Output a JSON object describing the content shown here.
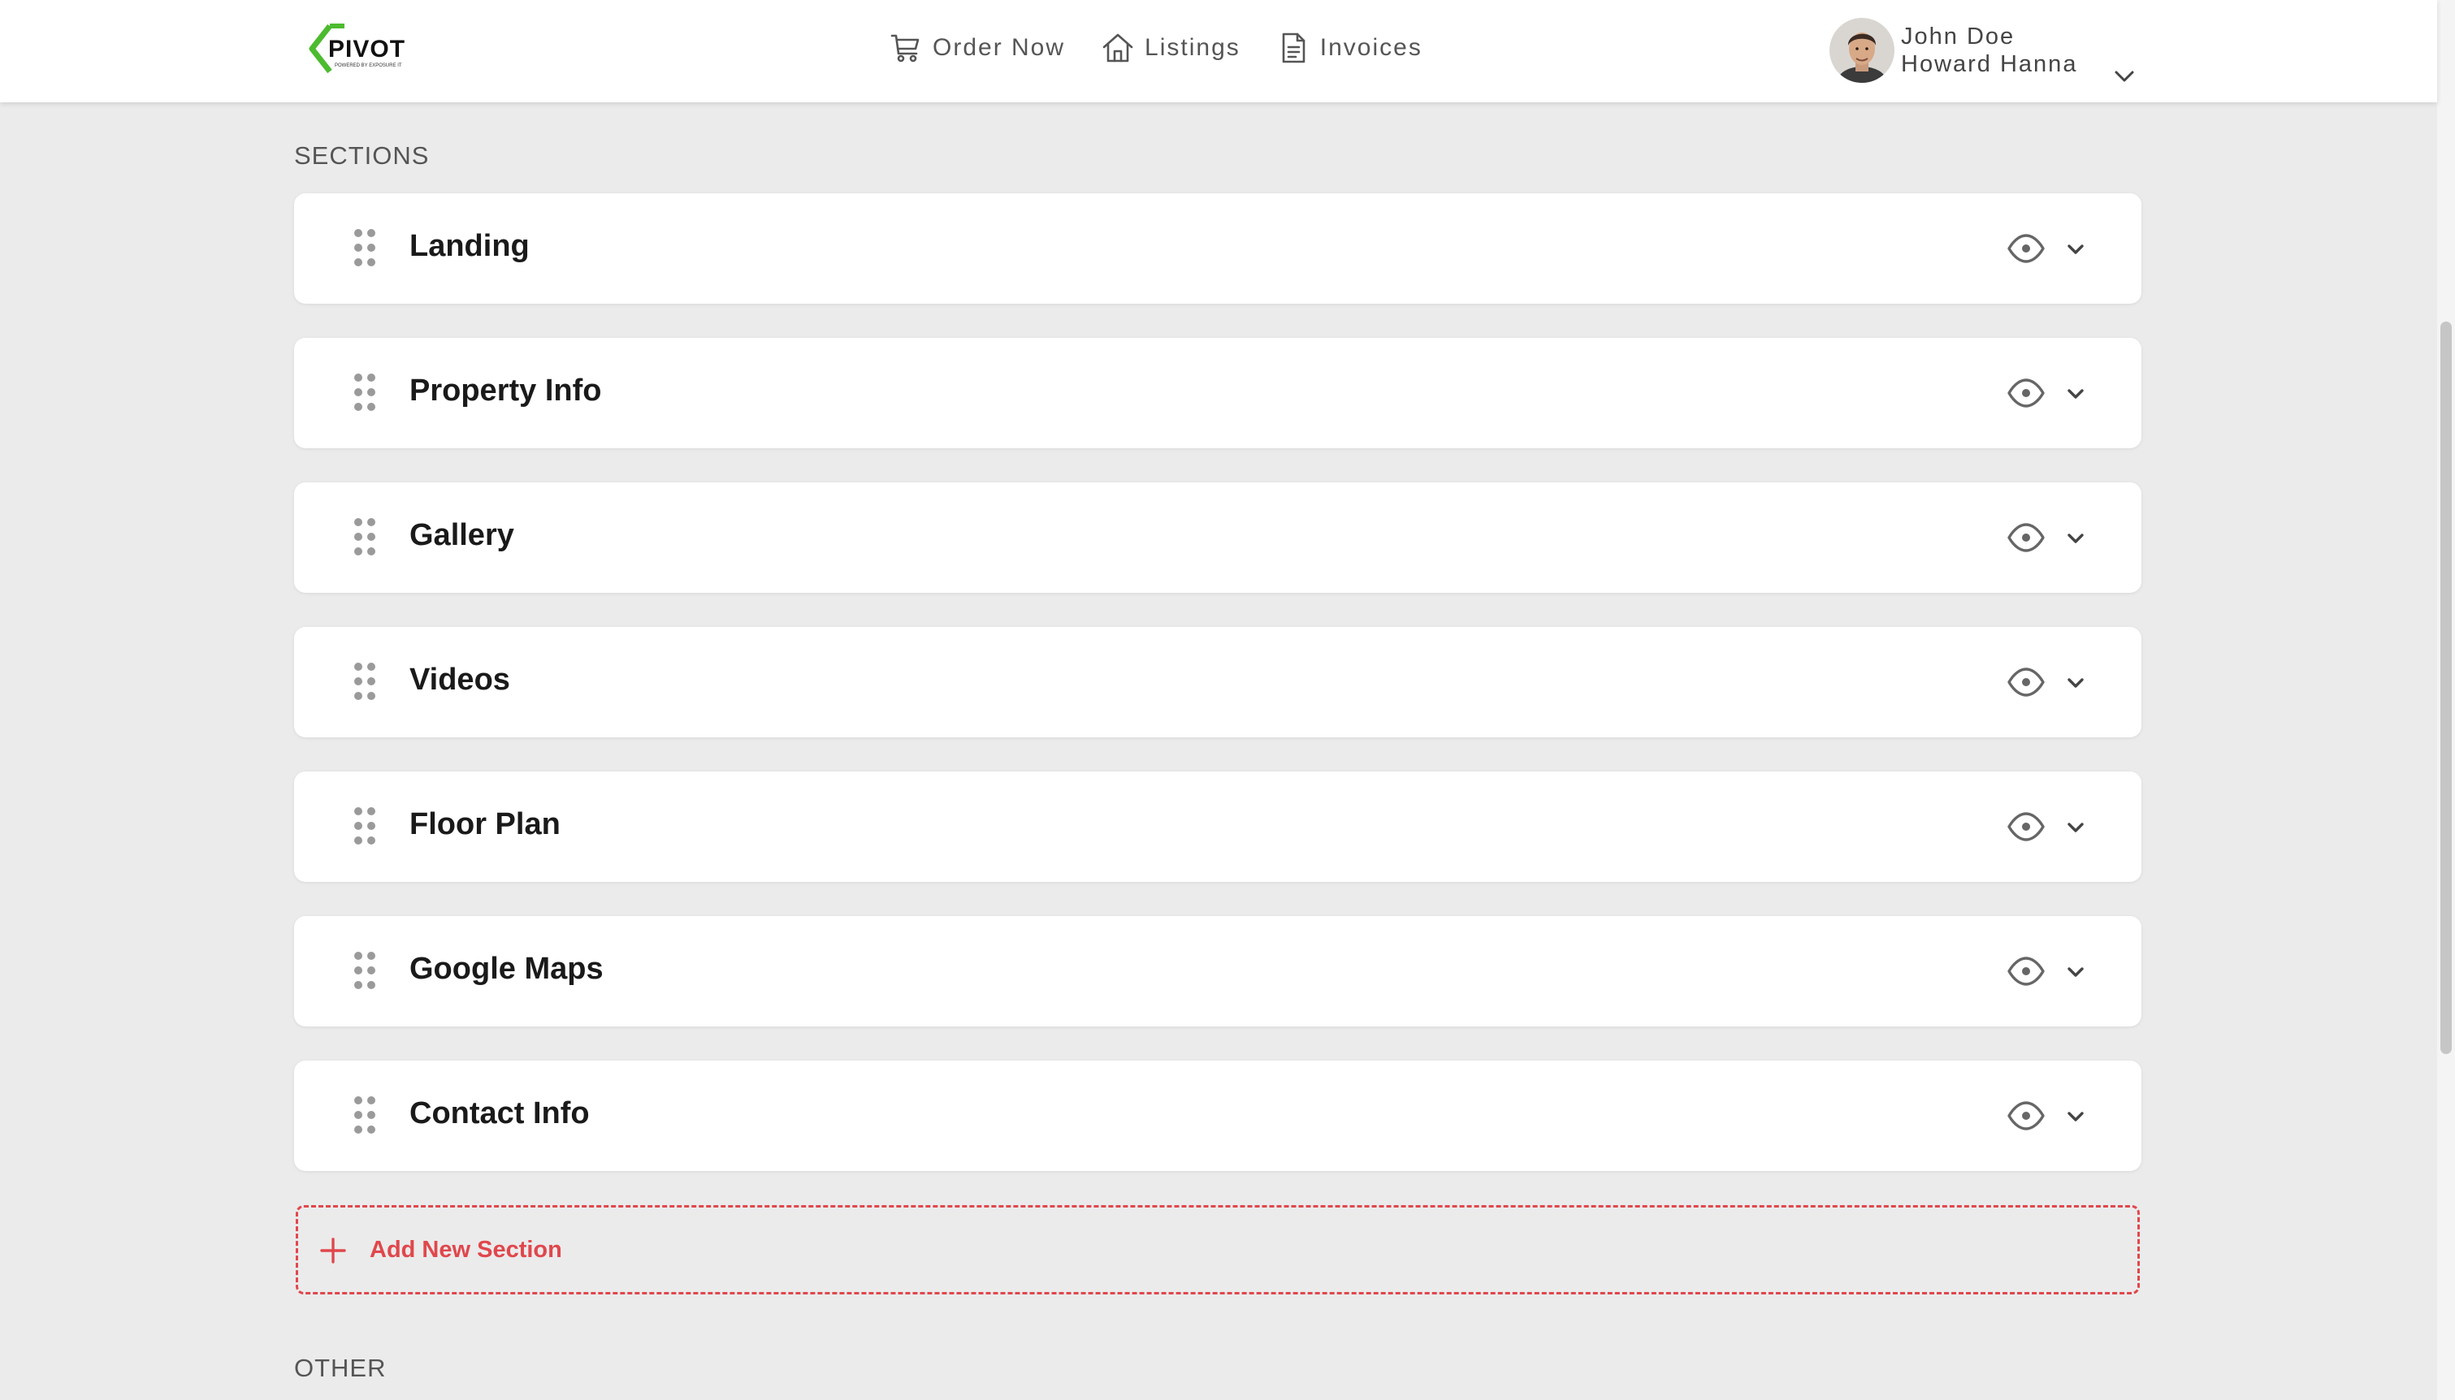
{
  "header": {
    "logo_text": "PIVOT",
    "logo_subtext": "POWERED BY EXPOSURE IT",
    "nav": [
      {
        "label": "Order Now",
        "icon": "cart-icon"
      },
      {
        "label": "Listings",
        "icon": "home-icon"
      },
      {
        "label": "Invoices",
        "icon": "document-icon"
      }
    ],
    "user": {
      "name": "John Doe",
      "company": "Howard Hanna"
    }
  },
  "sections_heading": "SECTIONS",
  "sections": [
    {
      "title": "Landing"
    },
    {
      "title": "Property Info"
    },
    {
      "title": "Gallery"
    },
    {
      "title": "Videos"
    },
    {
      "title": "Floor Plan"
    },
    {
      "title": "Google Maps"
    },
    {
      "title": "Contact Info"
    }
  ],
  "add_section_label": "Add New Section",
  "other_heading": "OTHER",
  "colors": {
    "accent_red": "#e0474c",
    "logo_green": "#4cbb2f",
    "background": "#ebebeb"
  }
}
